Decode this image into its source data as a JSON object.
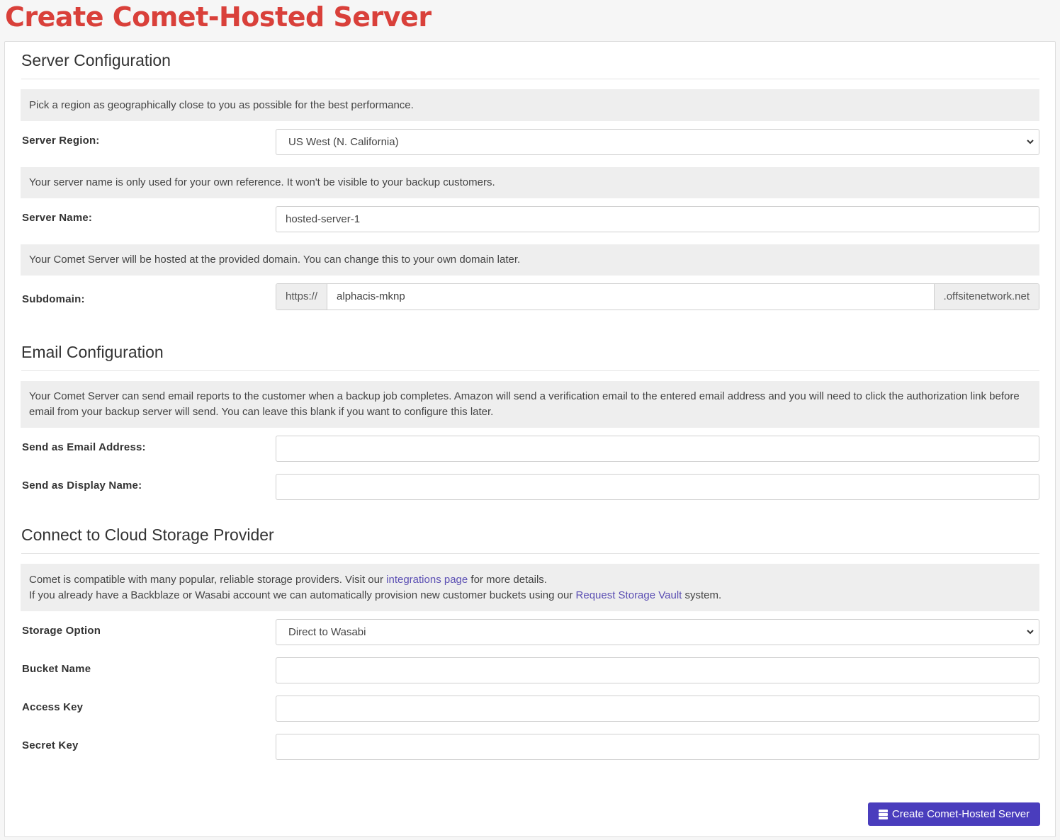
{
  "page_title": "Create Comet-Hosted Server",
  "server_config": {
    "title": "Server Configuration",
    "region_info": "Pick a region as geographically close to you as possible for the best performance.",
    "region_label": "Server Region:",
    "region_value": "US West (N. California)",
    "name_info": "Your server name is only used for your own reference. It won't be visible to your backup customers.",
    "name_label": "Server Name:",
    "name_value": "hosted-server-1",
    "domain_info": "Your Comet Server will be hosted at the provided domain. You can change this to your own domain later.",
    "subdomain_label": "Subdomain:",
    "subdomain_prefix": "https://",
    "subdomain_value": "alphacis-mknp",
    "subdomain_suffix": ".offsitenetwork.net"
  },
  "email_config": {
    "title": "Email Configuration",
    "info": "Your Comet Server can send email reports to the customer when a backup job completes. Amazon will send a verification email to the entered email address and you will need to click the authorization link before email from your backup server will send. You can leave this blank if you want to configure this later.",
    "address_label": "Send as Email Address:",
    "address_value": "",
    "display_label": "Send as Display Name:",
    "display_value": ""
  },
  "storage": {
    "title": "Connect to Cloud Storage Provider",
    "info_line1_pre": "Comet is compatible with many popular, reliable storage providers. Visit our ",
    "info_line1_link": "integrations page",
    "info_line1_post": " for more details.",
    "info_line2_pre": "If you already have a Backblaze or Wasabi account we can automatically provision new customer buckets using our ",
    "info_line2_link": "Request Storage Vault",
    "info_line2_post": " system.",
    "option_label": "Storage Option",
    "option_value": "Direct to Wasabi",
    "bucket_label": "Bucket Name",
    "bucket_value": "",
    "access_label": "Access Key",
    "access_value": "",
    "secret_label": "Secret Key",
    "secret_value": ""
  },
  "submit_label": "Create Comet-Hosted Server",
  "icons": {
    "select": "chevron-down-icon",
    "submit": "database-icon"
  },
  "colors": {
    "title": "#d9403a",
    "button": "#4a3dbd",
    "link": "#5b4fb3"
  }
}
